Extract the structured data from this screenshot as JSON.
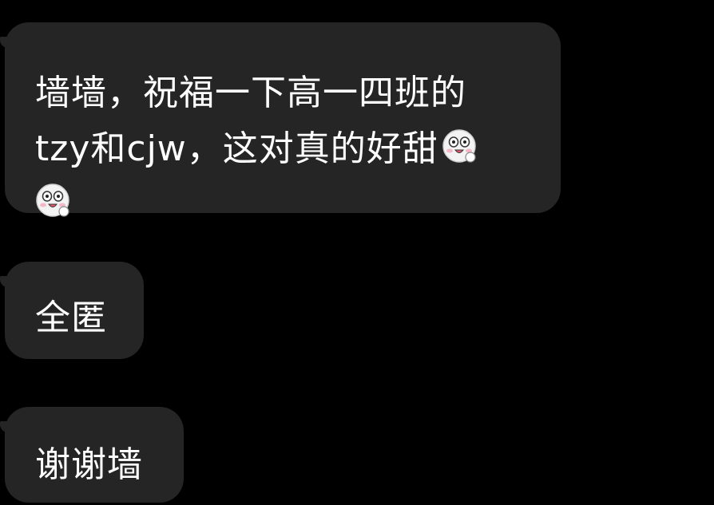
{
  "messages": [
    {
      "line1": "墙墙，祝福一下高一四班的",
      "line2": "tzy和cjw，这对真的好甜",
      "emojis": [
        "shocked-face-emoji",
        "shocked-face-emoji"
      ]
    },
    {
      "text": "全匿"
    },
    {
      "text": "谢谢墙"
    }
  ],
  "colors": {
    "background": "#000000",
    "bubble": "#252525",
    "text": "#ffffff"
  }
}
